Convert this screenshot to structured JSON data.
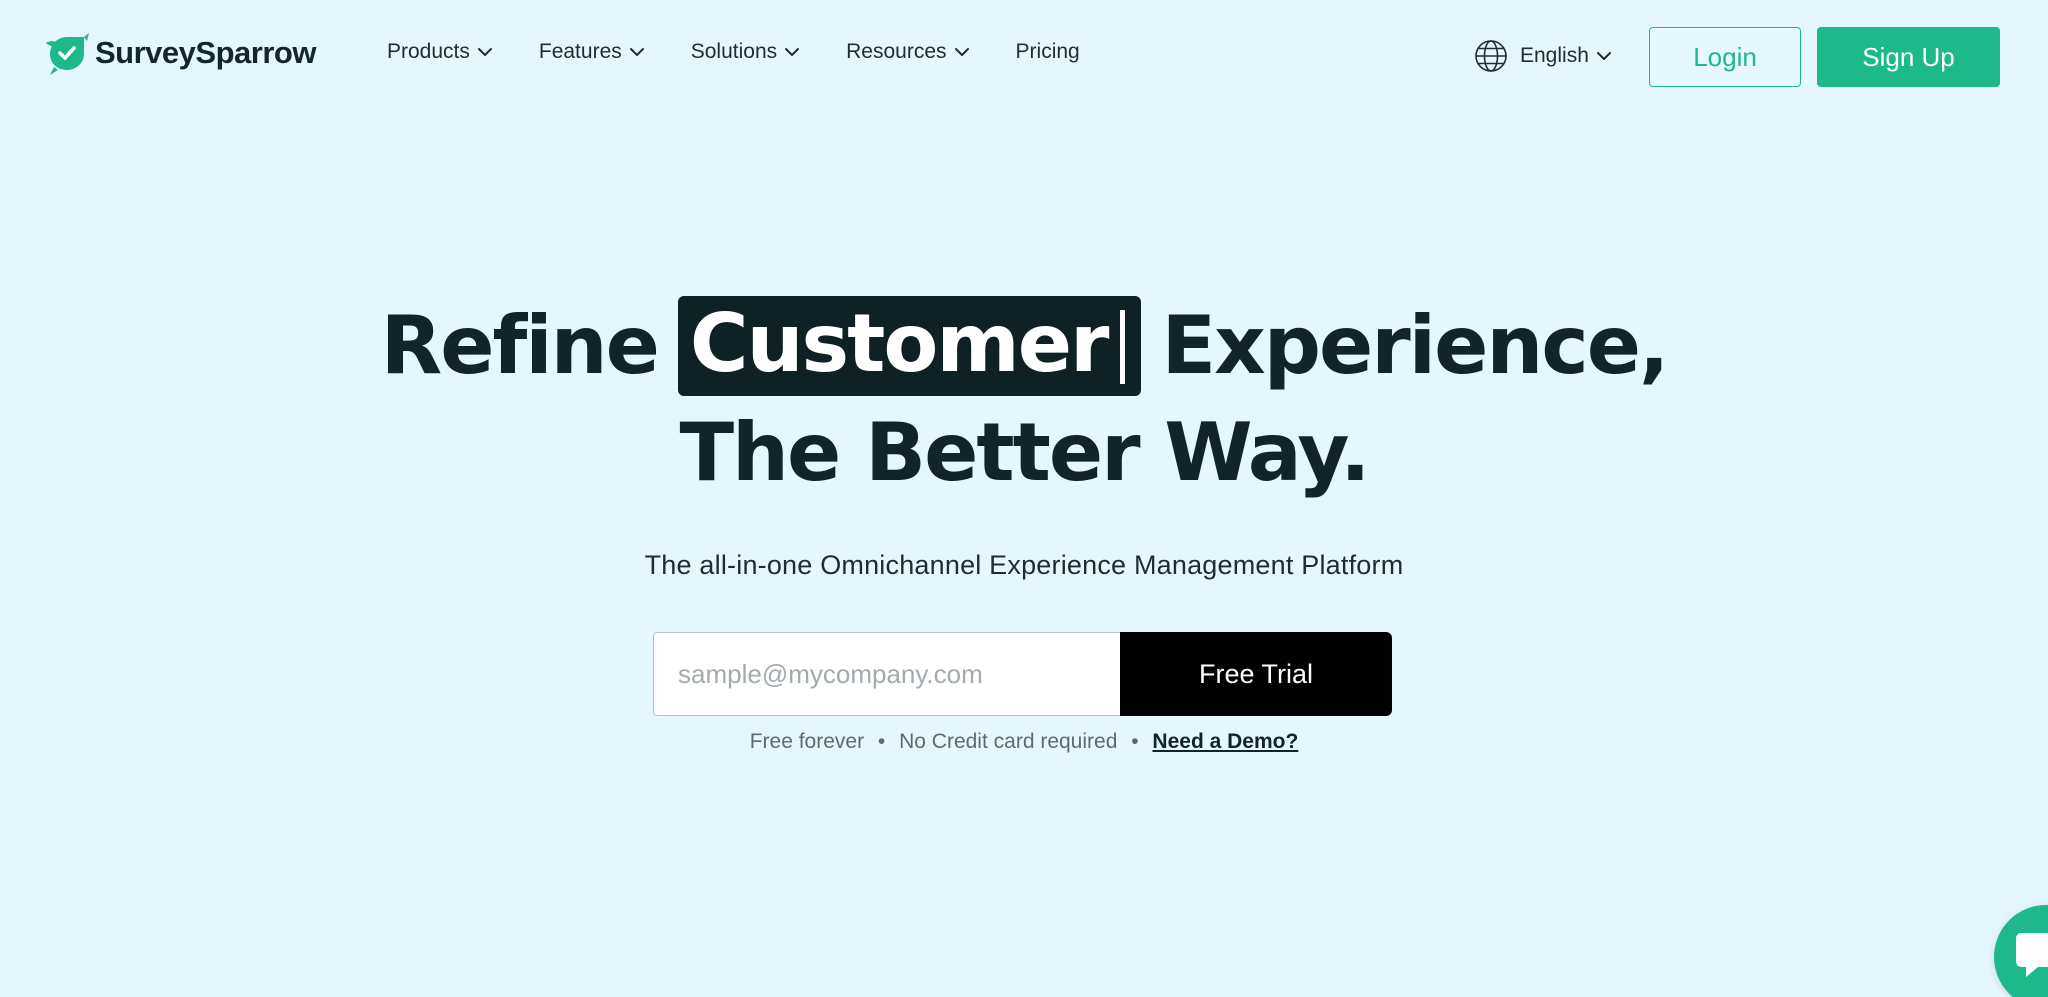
{
  "brand": {
    "name": "SurveySparrow",
    "color": "#1db98a"
  },
  "nav": {
    "items": [
      {
        "label": "Products",
        "has_dropdown": true
      },
      {
        "label": "Features",
        "has_dropdown": true
      },
      {
        "label": "Solutions",
        "has_dropdown": true
      },
      {
        "label": "Resources",
        "has_dropdown": true
      },
      {
        "label": "Pricing",
        "has_dropdown": false
      }
    ]
  },
  "language": {
    "label": "English",
    "icon": "globe-icon"
  },
  "auth": {
    "login_label": "Login",
    "signup_label": "Sign Up"
  },
  "hero": {
    "line1_before": "Refine",
    "highlight": "Customer",
    "line1_after": "Experience,",
    "line2": "The Better Way.",
    "subtitle": "The all-in-one Omnichannel Experience Management Platform"
  },
  "signup_form": {
    "email_value": "",
    "email_placeholder": "sample@mycompany.com",
    "cta_label": "Free Trial"
  },
  "footnote": {
    "part1": "Free forever",
    "separator": "•",
    "part2": "No Credit card required",
    "demo_link": "Need a Demo?"
  },
  "chat_widget": {
    "icon": "chat-bubble-icon",
    "color": "#1db98a"
  }
}
